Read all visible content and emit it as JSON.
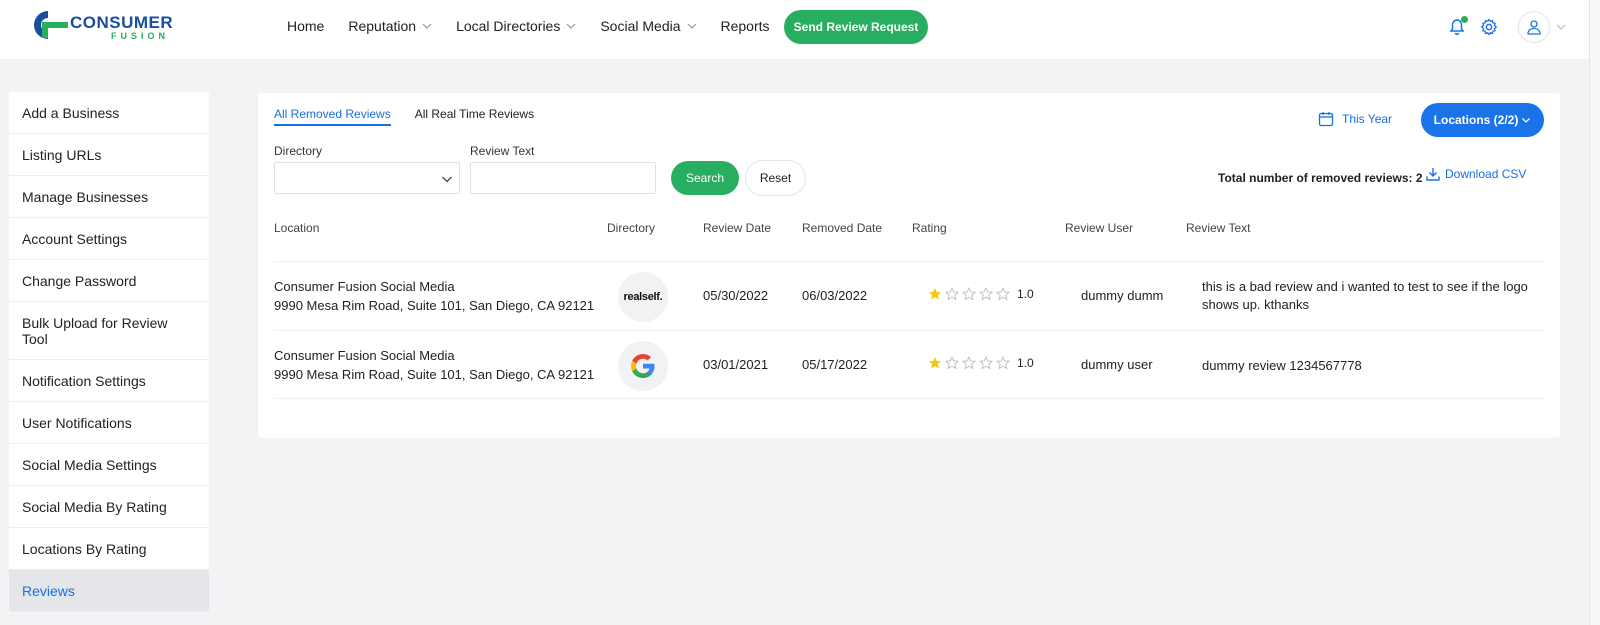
{
  "brand": {
    "name": "CONSUMER",
    "sub": "FUSION",
    "colors": {
      "blue": "#1a4fa0",
      "green": "#27ae60"
    }
  },
  "nav": {
    "items": [
      {
        "label": "Home",
        "dropdown": false
      },
      {
        "label": "Reputation",
        "dropdown": true
      },
      {
        "label": "Local Directories",
        "dropdown": true
      },
      {
        "label": "Social Media",
        "dropdown": true
      },
      {
        "label": "Reports",
        "dropdown": false
      }
    ],
    "send_review_label": "Send Review Request"
  },
  "sidebar": {
    "items": [
      {
        "label": "Add a Business"
      },
      {
        "label": "Listing URLs"
      },
      {
        "label": "Manage Businesses"
      },
      {
        "label": "Account Settings"
      },
      {
        "label": "Change Password"
      },
      {
        "label": "Bulk Upload for Review Tool"
      },
      {
        "label": "Notification Settings"
      },
      {
        "label": "User Notifications"
      },
      {
        "label": "Social Media Settings"
      },
      {
        "label": "Social Media By Rating"
      },
      {
        "label": "Locations By Rating"
      },
      {
        "label": "Reviews",
        "active": true
      }
    ]
  },
  "main": {
    "tabs": [
      {
        "label": "All Removed Reviews",
        "active": true
      },
      {
        "label": "All Real Time Reviews",
        "active": false
      }
    ],
    "date_range_label": "This Year",
    "locations_label": "Locations (2/2)",
    "filters": {
      "directory_label": "Directory",
      "directory_value": "",
      "review_text_label": "Review Text",
      "review_text_value": "",
      "search_label": "Search",
      "reset_label": "Reset"
    },
    "total_label": "Total number of removed reviews: 2",
    "download_label": "Download CSV",
    "table": {
      "columns": [
        "Location",
        "Directory",
        "Review Date",
        "Removed Date",
        "Rating",
        "Review User",
        "Review Text"
      ],
      "rows": [
        {
          "location_name": "Consumer Fusion Social Media",
          "location_address": "9990 Mesa Rim Road, Suite 101, San Diego, CA 92121",
          "directory": "realself.",
          "directory_icon": "realself-logo",
          "review_date": "05/30/2022",
          "removed_date": "06/03/2022",
          "rating": 1,
          "rating_label": "1.0",
          "review_user": "dummy dumm",
          "review_text": "this is a bad review and i wanted to test to see if the logo shows up. kthanks"
        },
        {
          "location_name": "Consumer Fusion Social Media",
          "location_address": "9990 Mesa Rim Road, Suite 101, San Diego, CA 92121",
          "directory": "Google",
          "directory_icon": "google-logo",
          "review_date": "03/01/2021",
          "removed_date": "05/17/2022",
          "rating": 1,
          "rating_label": "1.0",
          "review_user": "dummy user",
          "review_text": "dummy review 1234567778"
        }
      ]
    }
  }
}
